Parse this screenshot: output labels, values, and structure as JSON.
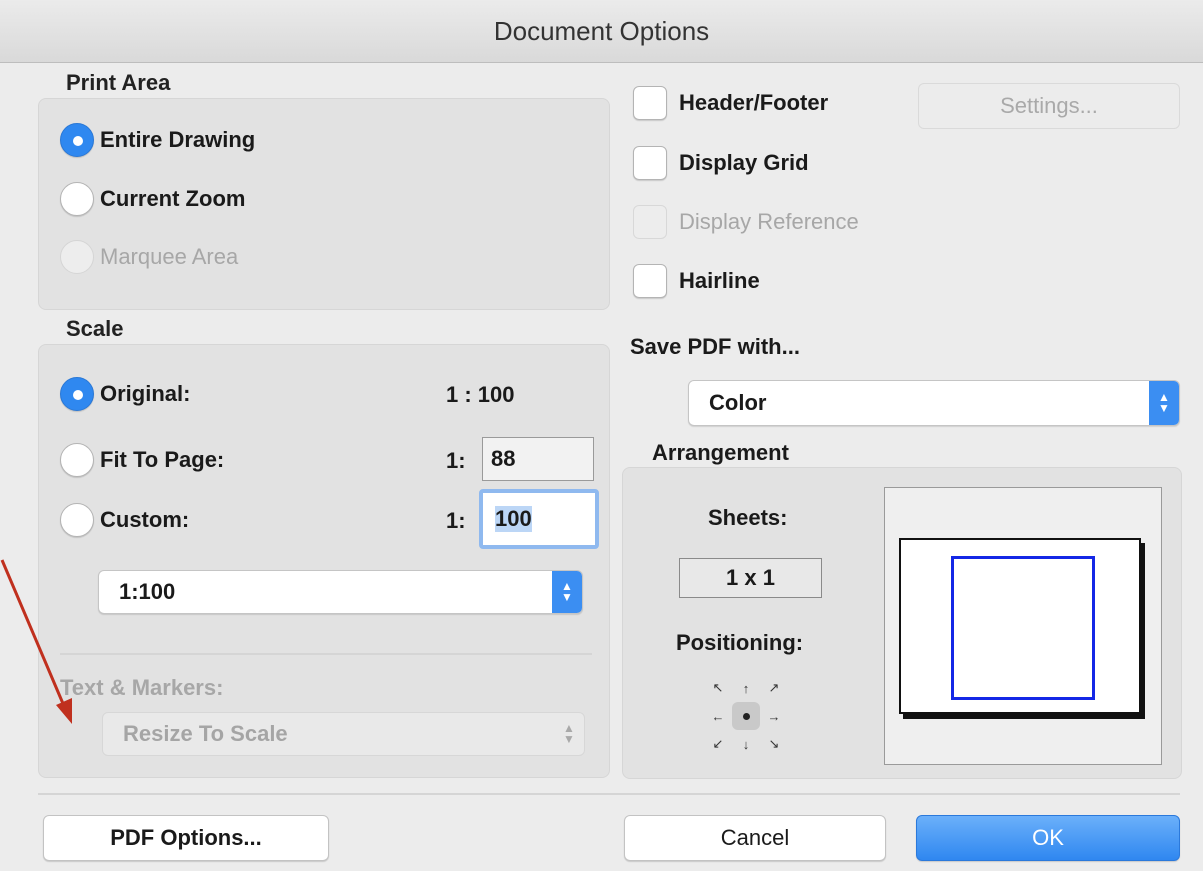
{
  "window": {
    "title": "Document Options"
  },
  "print_area": {
    "label": "Print Area",
    "options": [
      {
        "label": "Entire Drawing",
        "selected": true,
        "enabled": true
      },
      {
        "label": "Current Zoom",
        "selected": false,
        "enabled": true
      },
      {
        "label": "Marquee Area",
        "selected": false,
        "enabled": false
      }
    ]
  },
  "scale": {
    "label": "Scale",
    "original": {
      "label": "Original:",
      "value": "1 : 100"
    },
    "fit_to_page": {
      "label": "Fit To Page:",
      "prefix": "1:",
      "value": "88"
    },
    "custom": {
      "label": "Custom:",
      "prefix": "1:",
      "value": "100"
    },
    "scale_popup": "1:100",
    "text_markers": {
      "label": "Text & Markers:",
      "popup": "Resize To Scale"
    }
  },
  "options": {
    "header_footer": {
      "label": "Header/Footer",
      "checked": false
    },
    "settings_button": "Settings...",
    "display_grid": {
      "label": "Display Grid",
      "checked": false
    },
    "display_reference": {
      "label": "Display Reference",
      "checked": false,
      "enabled": false
    },
    "hairline": {
      "label": "Hairline",
      "checked": false
    }
  },
  "save_pdf": {
    "label": "Save PDF with...",
    "value": "Color"
  },
  "arrangement": {
    "label": "Arrangement",
    "sheets_label": "Sheets:",
    "sheets_value": "1 x 1",
    "positioning_label": "Positioning:",
    "positioning_arrows": [
      "↖",
      "↑",
      "↗",
      "←",
      "→",
      "↙",
      "↓",
      "↘"
    ]
  },
  "footer": {
    "pdf_options": "PDF Options...",
    "cancel": "Cancel",
    "ok": "OK"
  },
  "colors": {
    "accent": "#2f88f0",
    "print_area_outline": "#1428e6",
    "annotation_arrow": "#c0301e"
  }
}
